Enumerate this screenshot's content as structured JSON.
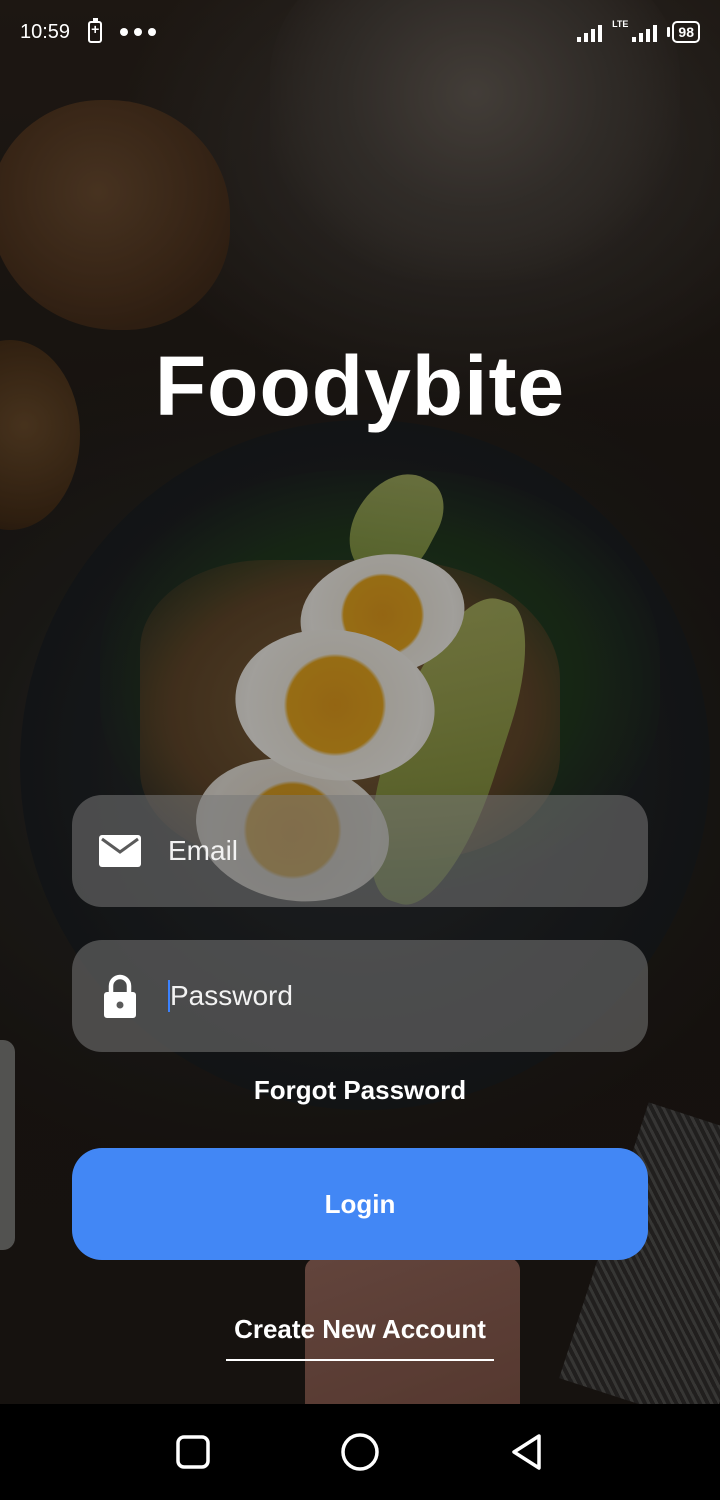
{
  "status_bar": {
    "time": "10:59",
    "network": "LTE",
    "battery": "98"
  },
  "app": {
    "title": "Foodybite"
  },
  "form": {
    "email": {
      "placeholder": "Email",
      "value": "",
      "icon": "mail-icon"
    },
    "password": {
      "placeholder": "Password",
      "value": "",
      "icon": "lock-icon"
    },
    "forgot_label": "Forgot Password",
    "login_label": "Login",
    "create_account_label": "Create New Account"
  },
  "colors": {
    "accent": "#4287f5",
    "field_bg": "rgba(120,120,120,0.55)",
    "caret": "#3b82ff"
  },
  "nav": {
    "recent_icon": "square-icon",
    "home_icon": "circle-icon",
    "back_icon": "triangle-back-icon"
  }
}
